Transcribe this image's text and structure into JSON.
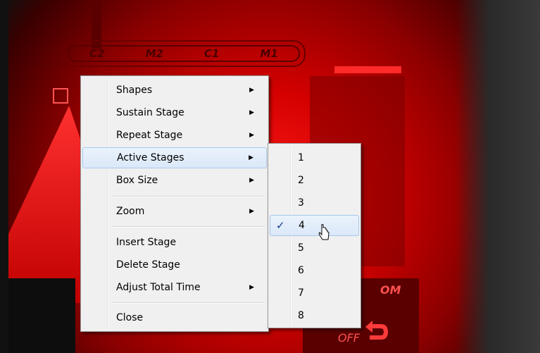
{
  "app": {
    "mode_buttons": [
      "C2",
      "M2",
      "C1",
      "M1"
    ],
    "label_om": "OM",
    "label_off": "OFF"
  },
  "context_menu": {
    "items": [
      {
        "label": "Shapes",
        "submenu": true
      },
      {
        "label": "Sustain Stage",
        "submenu": true
      },
      {
        "label": "Repeat Stage",
        "submenu": true
      },
      {
        "label": "Active Stages",
        "submenu": true,
        "highlighted": true
      },
      {
        "label": "Box Size",
        "submenu": true
      },
      {
        "label": "Zoom",
        "submenu": true
      },
      {
        "label": "Insert Stage",
        "submenu": false
      },
      {
        "label": "Delete Stage",
        "submenu": false
      },
      {
        "label": "Adjust Total Time",
        "submenu": true
      },
      {
        "label": "Close",
        "submenu": false
      }
    ],
    "arrow_glyph": "▶"
  },
  "submenu": {
    "items": [
      "1",
      "2",
      "3",
      "4",
      "5",
      "6",
      "7",
      "8"
    ],
    "checked": "4",
    "check_glyph": "✓"
  },
  "colors": {
    "accent_red": "#ff2a2a",
    "menu_highlight": "#dbe8f8",
    "menu_bg": "#f0f0f0"
  },
  "icons": [
    "undo-arrow-icon",
    "submenu-arrow-icon",
    "checkmark-icon",
    "mouse-pointer-icon"
  ]
}
